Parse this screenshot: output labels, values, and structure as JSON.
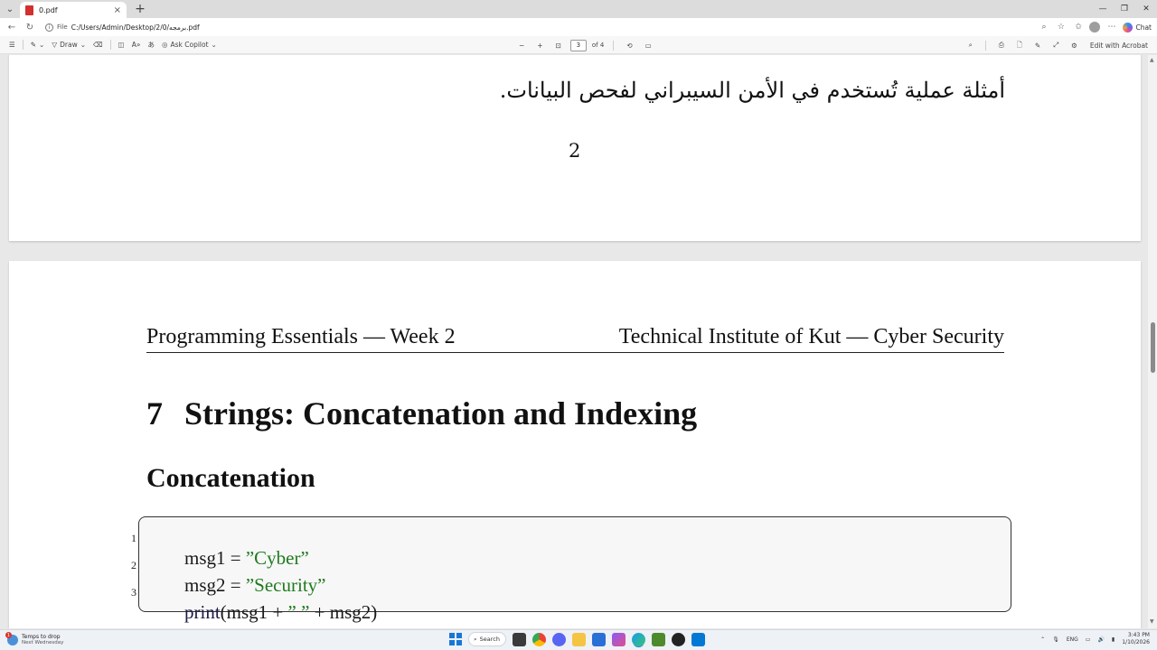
{
  "browser": {
    "tab_title": "0.pdf",
    "tab_close": "×",
    "new_tab": "+",
    "window_controls": {
      "minimize": "—",
      "restore": "❐",
      "close": "✕"
    },
    "url_scheme": "File",
    "url_path": "C:/Users/Admin/Desktop/2/0/برمجه.pdf",
    "chat_label": "Chat"
  },
  "toolbar": {
    "draw_label": "Draw",
    "ask_copilot_label": "Ask Copilot",
    "page_current": "3",
    "page_of": "of 4",
    "edit_acrobat_label": "Edit with Acrobat"
  },
  "document": {
    "prev_page": {
      "arabic_text": "أمثلة عملية تُستخدم في الأمن السيبراني لفحص البيانات.",
      "page_number": "2"
    },
    "current_page": {
      "header_left": "Programming Essentials — Week 2",
      "header_right": "Technical Institute of Kut — Cyber Security",
      "section_number": "7",
      "section_title": "Strings: Concatenation and Indexing",
      "subsection_title": "Concatenation",
      "code_lines": [
        {
          "num": "1",
          "left": "msg1 = ",
          "str": "”Cyber”"
        },
        {
          "num": "2",
          "left": "msg2 = ",
          "str": "”Security”"
        },
        {
          "num": "3",
          "fn": "print",
          "rest_a": "(msg1 + ",
          "str": "” ”",
          "rest_b": " + msg2)"
        }
      ]
    }
  },
  "taskbar": {
    "weather_line1": "Temps to drop",
    "weather_line2": "Next Wednesday",
    "weather_badge": "1",
    "search_label": "Search",
    "language": "ENG",
    "time": "3:43 PM",
    "date": "1/10/2026"
  },
  "colors": {
    "code_string": "#1f7a1f",
    "pdf_badge": "#d32f2f",
    "start_blue": "#1877d6"
  }
}
